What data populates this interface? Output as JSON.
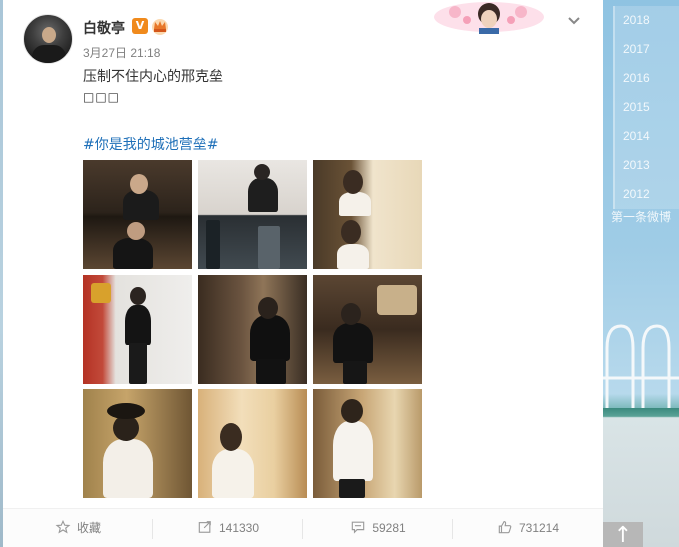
{
  "post": {
    "author_name": "白敬亭",
    "verified_badge": "V",
    "datetime": "3月27日 21:18",
    "text": "压制不住内心的邢克垒",
    "emoji_placeholder": "□□□",
    "hashtag": "#你是我的城池营垒#",
    "photos_count": 9
  },
  "actions": {
    "favorite_label": "收藏",
    "repost_count": "141330",
    "comment_count": "59281",
    "like_count": "731214"
  },
  "timeline": {
    "years": [
      "2018",
      "2017",
      "2016",
      "2015",
      "2014",
      "2013",
      "2012"
    ],
    "first_weibo": "第一条微博"
  },
  "colors": {
    "link_blue": "#1e6fb8",
    "badge_orange": "#f08a1c",
    "meta_gray": "#808080"
  },
  "icons": {
    "favorite": "star-icon",
    "repost": "repost-icon",
    "comment": "comment-icon",
    "like": "thumbs-up-icon",
    "menu": "chevron-down-icon",
    "back_to_top": "arrow-up-icon"
  }
}
